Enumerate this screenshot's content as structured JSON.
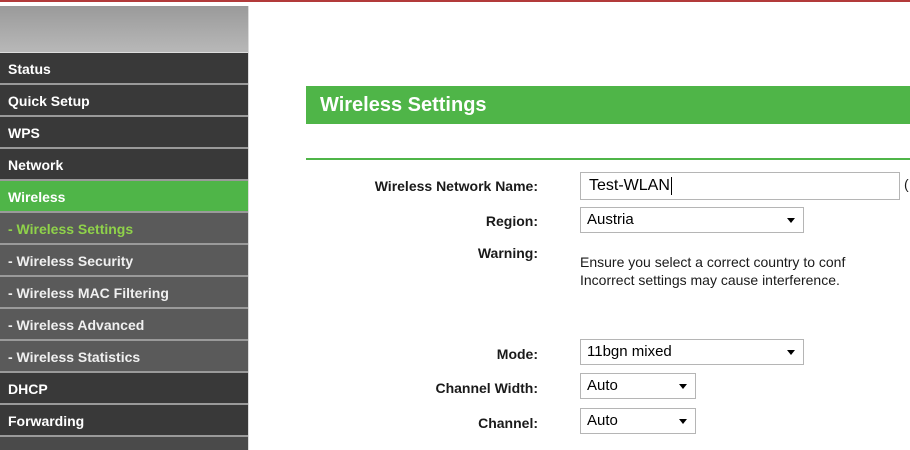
{
  "sidebar": {
    "items": [
      {
        "label": "Status"
      },
      {
        "label": "Quick Setup"
      },
      {
        "label": "WPS"
      },
      {
        "label": "Network"
      },
      {
        "label": "Wireless"
      },
      {
        "label": "- Wireless Settings"
      },
      {
        "label": "- Wireless Security"
      },
      {
        "label": "- Wireless MAC Filtering"
      },
      {
        "label": "- Wireless Advanced"
      },
      {
        "label": "- Wireless Statistics"
      },
      {
        "label": "DHCP"
      },
      {
        "label": "Forwarding"
      }
    ]
  },
  "page": {
    "title": "Wireless Settings"
  },
  "form": {
    "network_name": {
      "label": "Wireless Network Name:",
      "value": "Test-WLAN",
      "hint": "("
    },
    "region": {
      "label": "Region:",
      "value": "Austria"
    },
    "warning": {
      "label": "Warning:",
      "line1": "Ensure you select a correct country to conf",
      "line2": "Incorrect settings may cause interference."
    },
    "mode": {
      "label": "Mode:",
      "value": "11bgn mixed"
    },
    "channel_width": {
      "label": "Channel Width:",
      "value": "Auto"
    },
    "channel": {
      "label": "Channel:",
      "value": "Auto"
    }
  },
  "colors": {
    "accent": "#4fb548",
    "sidebar_bg": "#393939",
    "submenu_bg": "#5a5a5a",
    "selected_submenu_text": "#8fd24a"
  },
  "icons": {
    "dropdown": "chevron-down-icon"
  }
}
